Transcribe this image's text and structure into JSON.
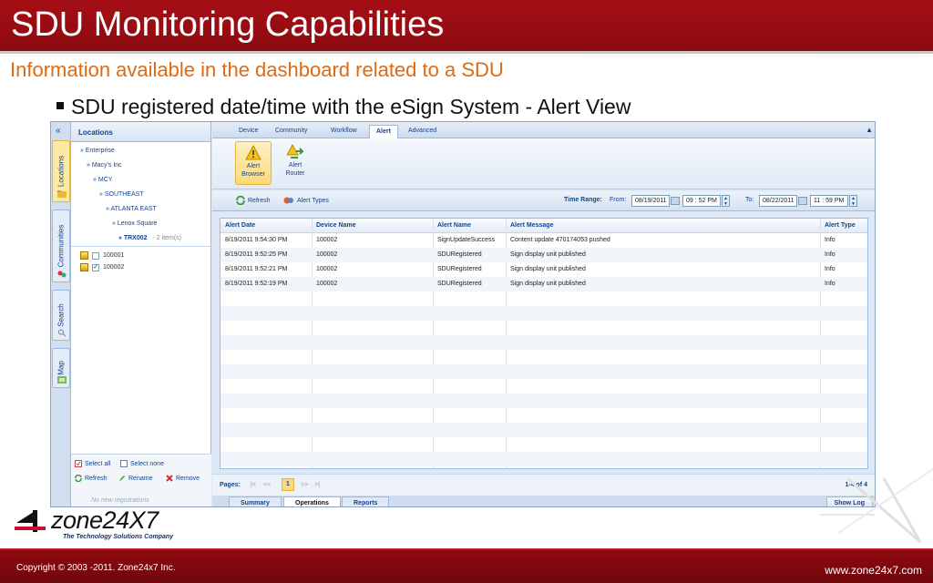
{
  "slide": {
    "title": "SDU Monitoring Capabilities",
    "subtitle": "Information available in the dashboard related to a SDU",
    "bullet": "SDU registered date/time with the eSign System  - Alert View"
  },
  "app": {
    "side_tabs": [
      {
        "label": "Locations",
        "active": true
      },
      {
        "label": "Communities",
        "active": false
      },
      {
        "label": "Search",
        "active": false
      },
      {
        "label": "Map",
        "active": false
      }
    ],
    "collapse_symbol": "«",
    "tree": {
      "header": "Locations",
      "nodes": [
        {
          "label": "» Enterprise"
        },
        {
          "label": "» Macy's Inc"
        },
        {
          "label": "» MCY"
        },
        {
          "label": "» SOUTHEAST"
        },
        {
          "label": "» ATLANTA EAST"
        },
        {
          "label": "» Lenox Square"
        },
        {
          "label": "» TRX002",
          "count": "-  2 item(s)"
        }
      ],
      "devices": [
        {
          "id": "100001",
          "checked": false,
          "check_mark": ""
        },
        {
          "id": "100002",
          "checked": true,
          "check_mark": "✓"
        }
      ],
      "actions": {
        "select_all": "Select all",
        "select_none": "Select none",
        "refresh": "Refresh",
        "rename": "Rename",
        "remove": "Remove"
      },
      "status": "No new registrations"
    },
    "top_tabs": [
      {
        "label": "Device",
        "active": false
      },
      {
        "label": "Community",
        "active": false
      },
      {
        "label": "Workflow",
        "active": false
      },
      {
        "label": "Alert",
        "active": true
      },
      {
        "label": "Advanced",
        "active": false
      }
    ],
    "ribbon": {
      "alert_browser_line1": "Alert",
      "alert_browser_line2": "Browser",
      "alert_router_line1": "Alert",
      "alert_router_line2": "Router"
    },
    "toolbar": {
      "refresh": "Refresh",
      "alert_types": "Alert Types",
      "time_range": "Time Range:",
      "from": "From:",
      "from_date": "08/19/2011",
      "from_time": "09 : 52  PM",
      "to": "To:",
      "to_date": "08/22/2011",
      "to_time": "11 : 59  PM"
    },
    "grid": {
      "columns": [
        "Alert Date",
        "Device Name",
        "Alert Name",
        "Alert Message",
        "Alert Type"
      ],
      "rows": [
        [
          "8/19/2011 9:54:30 PM",
          "100002",
          "SignUpdateSuccess",
          "Content update 470174053 pushed",
          "Info"
        ],
        [
          "8/19/2011 9:52:25 PM",
          "100002",
          "SDURegistered",
          "Sign display unit published",
          "Info"
        ],
        [
          "8/19/2011 9:52:21 PM",
          "100002",
          "SDURegistered",
          "Sign display unit published",
          "Info"
        ],
        [
          "8/19/2011 9:52:19 PM",
          "100002",
          "SDURegistered",
          "Sign display unit published",
          "Info"
        ]
      ]
    },
    "pager": {
      "label": "Pages:",
      "first": "|<",
      "prev": "<<",
      "current": "1",
      "next": ">>",
      "last": ">|",
      "count": "1-4 of 4"
    },
    "bottom_tabs": [
      {
        "label": "Summary",
        "active": false
      },
      {
        "label": "Operations",
        "active": true
      },
      {
        "label": "Reports",
        "active": false
      }
    ],
    "show_log": "Show Log",
    "collapse_up": "▲"
  },
  "logo": {
    "text": "zone24X7",
    "tagline": "The Technology Solutions Company"
  },
  "footer": {
    "copyright": "Copyright © 2003 -2011. Zone24x7 Inc.",
    "website": "www.zone24x7.com"
  },
  "colors": {
    "brand_red": "#a50f15",
    "subtitle_orange": "#e06a12",
    "ext_blue": "#15428b"
  }
}
